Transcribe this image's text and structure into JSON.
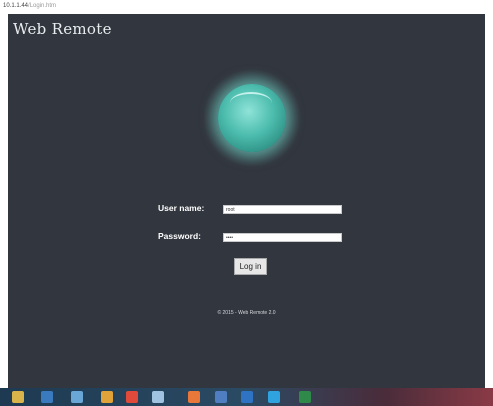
{
  "browser": {
    "address_host": "10.1.1.44",
    "address_path": "/Login.htm"
  },
  "app": {
    "title": "Web Remote"
  },
  "form": {
    "username_label": "User name:",
    "username_value": "root",
    "password_label": "Password:",
    "password_value": "••••",
    "login_button": "Log in"
  },
  "footer": {
    "copyright": "© 2015 - Web Remote 2.0"
  },
  "taskbar": {
    "icons": [
      {
        "name": "file-explorer-icon",
        "color": "#d9b44a"
      },
      {
        "name": "media-player-icon",
        "color": "#3a7bbf"
      },
      {
        "name": "network-icon",
        "color": "#6aa7d6"
      },
      {
        "name": "paint-icon",
        "color": "#e0a33a"
      },
      {
        "name": "chrome-icon",
        "color": "#e04a3a"
      },
      {
        "name": "monitor-icon",
        "color": "#9fc3e0"
      },
      {
        "name": "firefox-icon",
        "color": "#e8783a"
      },
      {
        "name": "save-icon",
        "color": "#4f7fc2"
      },
      {
        "name": "outlook-icon",
        "color": "#2f74c4"
      },
      {
        "name": "skype-icon",
        "color": "#2ea3e0"
      },
      {
        "name": "excel-icon",
        "color": "#2f8a4a"
      }
    ]
  }
}
